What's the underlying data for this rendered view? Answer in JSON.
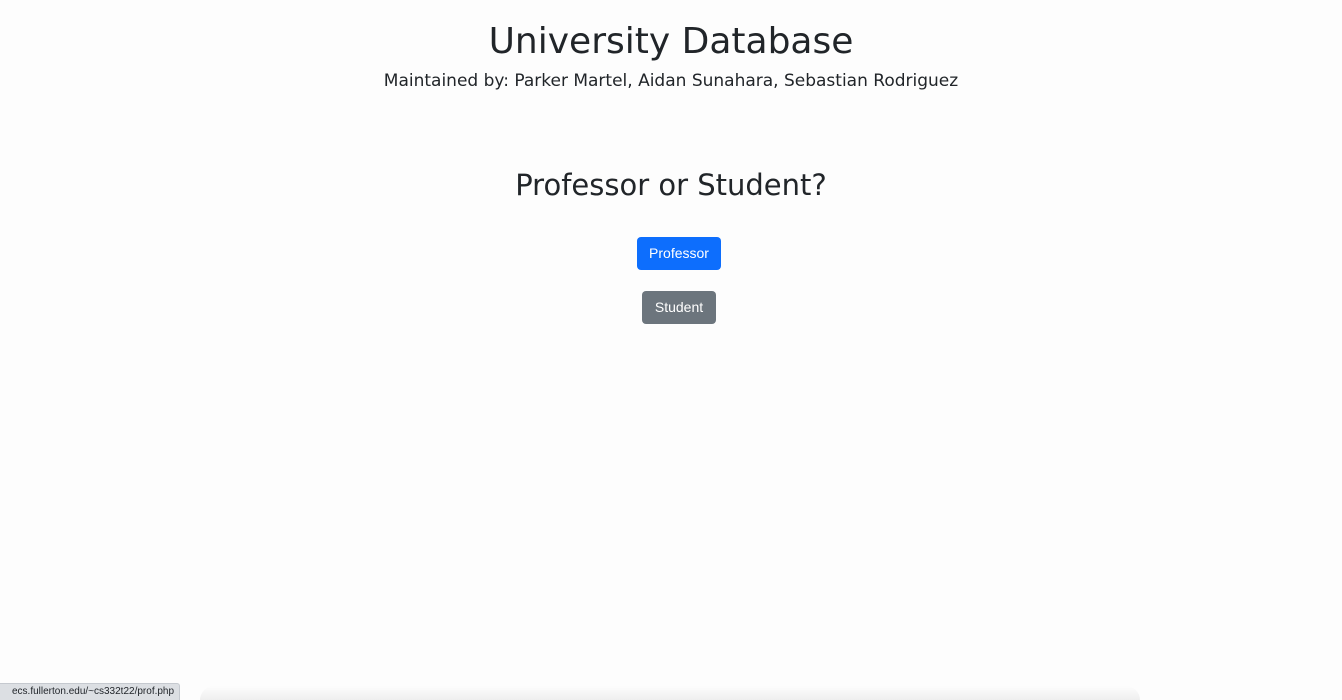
{
  "header": {
    "title": "University Database",
    "maintainers": "Maintained by: Parker Martel, Aidan Sunahara, Sebastian Rodriguez"
  },
  "main": {
    "question": "Professor or Student?",
    "professor_button": "Professor",
    "student_button": "Student"
  },
  "status_bar": {
    "url": "ecs.fullerton.edu/~cs332t22/prof.php"
  },
  "colors": {
    "primary": "#0d6efd",
    "secondary": "#6c757d",
    "text": "#212529"
  }
}
